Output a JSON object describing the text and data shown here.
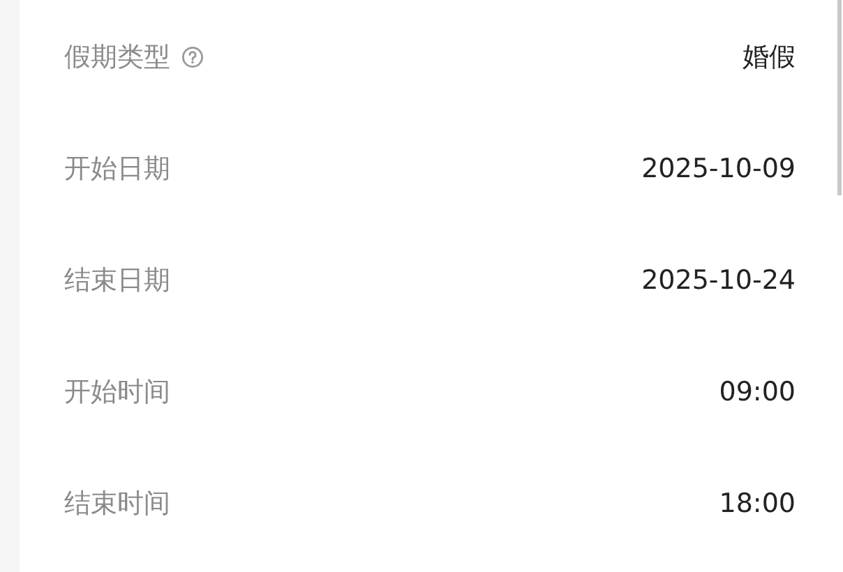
{
  "fields": [
    {
      "label": "假期类型",
      "help": true,
      "value": "婚假"
    },
    {
      "label": "开始日期",
      "help": false,
      "value": "2025-10-09"
    },
    {
      "label": "结束日期",
      "help": false,
      "value": "2025-10-24"
    },
    {
      "label": "开始时间",
      "help": false,
      "value": "09:00"
    },
    {
      "label": "结束时间",
      "help": false,
      "value": "18:00"
    }
  ]
}
